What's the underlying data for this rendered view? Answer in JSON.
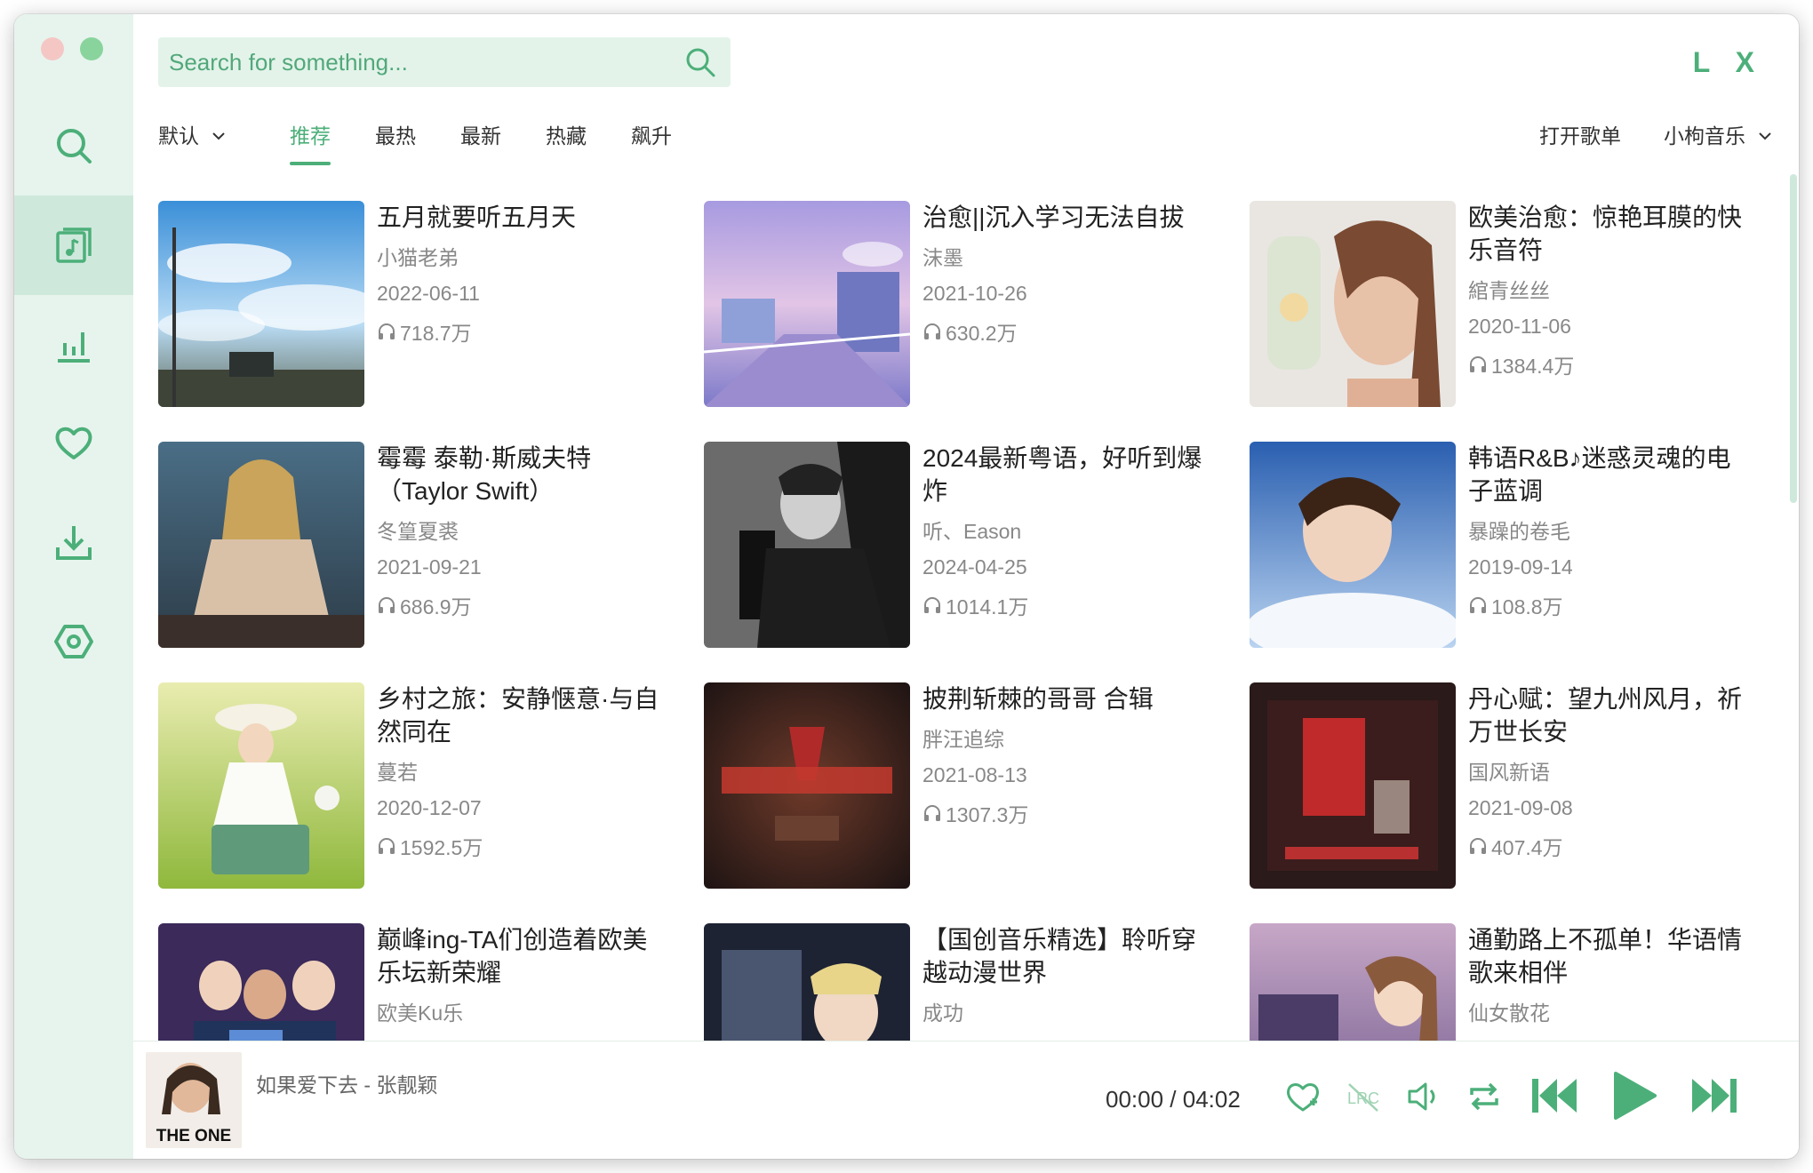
{
  "app": {
    "logo": "L X"
  },
  "search": {
    "placeholder": "Search for something..."
  },
  "sidebar": {
    "items": [
      {
        "name": "search",
        "icon": "search-icon"
      },
      {
        "name": "songlist",
        "icon": "music-list-icon",
        "active": true
      },
      {
        "name": "leaderboard",
        "icon": "bar-chart-icon"
      },
      {
        "name": "favorites",
        "icon": "heart-icon"
      },
      {
        "name": "download",
        "icon": "download-icon"
      },
      {
        "name": "settings",
        "icon": "settings-icon"
      }
    ]
  },
  "tabs": {
    "sort_label": "默认",
    "items": [
      {
        "label": "推荐",
        "active": true
      },
      {
        "label": "最热"
      },
      {
        "label": "最新"
      },
      {
        "label": "热藏"
      },
      {
        "label": "飙升"
      }
    ]
  },
  "actions": {
    "open_list": "打开歌单",
    "source": "小枸音乐"
  },
  "playlists": [
    {
      "title": "五月就要听五月天",
      "author": "小猫老弟",
      "date": "2022-06-11",
      "plays": "718.7万"
    },
    {
      "title": "治愈||沉入学习无法自拔",
      "author": "沫墨",
      "date": "2021-10-26",
      "plays": "630.2万"
    },
    {
      "title": "欧美治愈：惊艳耳膜的快乐音符",
      "author": "綰青丝丝",
      "date": "2020-11-06",
      "plays": "1384.4万"
    },
    {
      "title": "霉霉 泰勒·斯威夫特（Taylor Swift）",
      "author": "冬篁夏裘",
      "date": "2021-09-21",
      "plays": "686.9万"
    },
    {
      "title": "2024最新粤语，好听到爆炸",
      "author": "听、Eason",
      "date": "2024-04-25",
      "plays": "1014.1万"
    },
    {
      "title": "韩语R&B♪迷惑灵魂的电子蓝调",
      "author": "暴躁的卷毛",
      "date": "2019-09-14",
      "plays": "108.8万"
    },
    {
      "title": "乡村之旅：安静惬意·与自然同在",
      "author": "蔓若",
      "date": "2020-12-07",
      "plays": "1592.5万"
    },
    {
      "title": "披荆斩棘的哥哥 合辑",
      "author": "胖汪追综",
      "date": "2021-08-13",
      "plays": "1307.3万"
    },
    {
      "title": "丹心赋：望九州风月，祈万世长安",
      "author": "国风新语",
      "date": "2021-09-08",
      "plays": "407.4万"
    },
    {
      "title": "巅峰ing-TA们创造着欧美乐坛新荣耀",
      "author": "欧美Ku乐",
      "date": "",
      "plays": ""
    },
    {
      "title": "【国创音乐精选】聆听穿越动漫世界",
      "author": "成功",
      "date": "",
      "plays": ""
    },
    {
      "title": "通勤路上不孤单！华语情歌来相伴",
      "author": "仙女散花",
      "date": "",
      "plays": ""
    }
  ],
  "player": {
    "now_playing": "如果爱下去 - 张靓颖",
    "cover_text": "THE ONE",
    "time": "00:00 / 04:02",
    "controls": [
      "heart-outline-icon",
      "lyrics-icon",
      "volume-icon",
      "repeat-icon",
      "previous-icon",
      "play-icon",
      "next-icon"
    ]
  },
  "colors": {
    "accent": "#4caf79",
    "sidebar_bg": "#e7f4ee",
    "search_bg": "#e3f3ea"
  }
}
